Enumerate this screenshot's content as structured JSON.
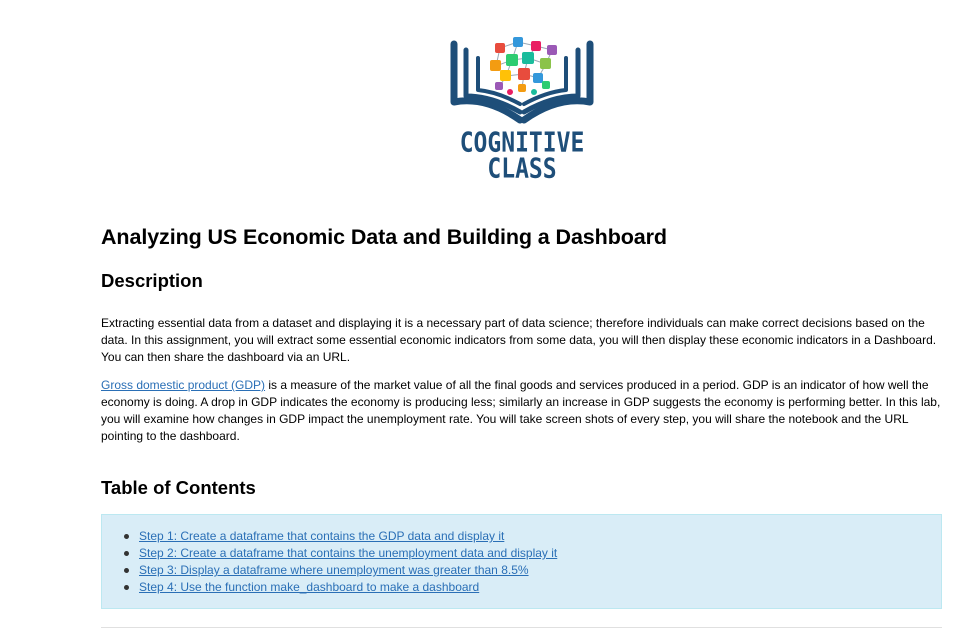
{
  "logo": {
    "line1": "COGNITIVE",
    "line2": "CLASS",
    "colors": {
      "book": "#1e4e79",
      "network": [
        "#e84c3d",
        "#f39c12",
        "#2ecc71",
        "#3498db",
        "#9b59b6",
        "#1abc9c",
        "#e91e63",
        "#8bc34a",
        "#ffc107"
      ]
    }
  },
  "title": "Analyzing US Economic Data and Building a Dashboard",
  "description": {
    "heading": "Description",
    "paragraph1": "Extracting essential data from a dataset and displaying it is a necessary part of data science; therefore individuals can make correct decisions based on the data. In this assignment, you will extract some essential economic indicators from some data, you will then display these economic indicators in a Dashboard. You can then share the dashboard via an URL.",
    "paragraph2_link": "Gross domestic product (GDP)",
    "paragraph2_rest": " is a measure of the market value of all the final goods and services produced in a period. GDP is an indicator of how well the economy is doing. A drop in GDP indicates the economy is producing less; similarly an increase in GDP suggests the economy is performing better. In this lab, you will examine how changes in GDP impact the unemployment rate. You will take screen shots of every step, you will share the notebook and the URL pointing to the dashboard."
  },
  "toc": {
    "heading": "Table of Contents",
    "items": [
      {
        "label": "Step 1: Create a dataframe that contains the GDP data and display it"
      },
      {
        "label": "Step 2: Create a dataframe that contains the unemployment data and display it"
      },
      {
        "label": "Step 3: Display a dataframe where unemployment was greater than 8.5%"
      },
      {
        "label": "Step 4: Use the function make_dashboard to make a dashboard"
      }
    ]
  },
  "colors": {
    "link": "#2a6fb6",
    "toc_background": "#d9edf7",
    "toc_border": "#bce8f1"
  }
}
